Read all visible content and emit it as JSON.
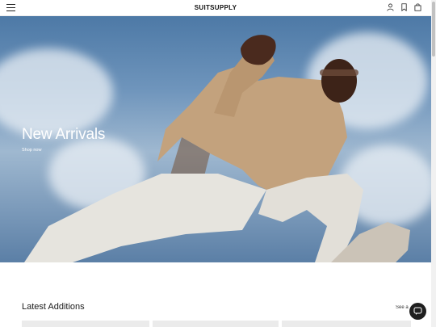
{
  "header": {
    "brand": "SUITSUPPLY",
    "menu_icon": "hamburger-menu-icon",
    "icons": [
      "user-icon",
      "bookmark-icon",
      "shopping-bag-icon"
    ]
  },
  "hero": {
    "title": "New Arrivals",
    "link_label": "Shop now"
  },
  "latest": {
    "title": "Latest Additions",
    "see_all_label": "See all"
  },
  "chat": {
    "icon": "chat-bubble-icon"
  },
  "colors": {
    "accent": "#1f1f1f",
    "sky": "#6f95bc",
    "card": "#ebebeb"
  }
}
